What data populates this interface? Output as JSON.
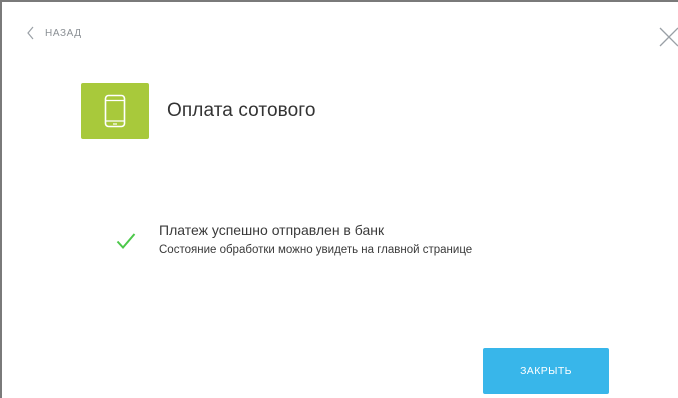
{
  "nav": {
    "back_label": "НАЗАД",
    "back_icon": "chevron-left-icon",
    "close_icon": "close-icon"
  },
  "service": {
    "title": "Оплата сотового",
    "icon": "mobile-phone-icon",
    "icon_bg": "#a8c93b"
  },
  "status": {
    "icon": "check-icon",
    "icon_color": "#4cc84a",
    "title": "Платеж успешно отправлен в банк",
    "subtitle": "Состояние обработки можно увидеть на главной странице"
  },
  "actions": {
    "close_label": "ЗАКРЫТЬ",
    "close_color": "#38b6ea"
  }
}
